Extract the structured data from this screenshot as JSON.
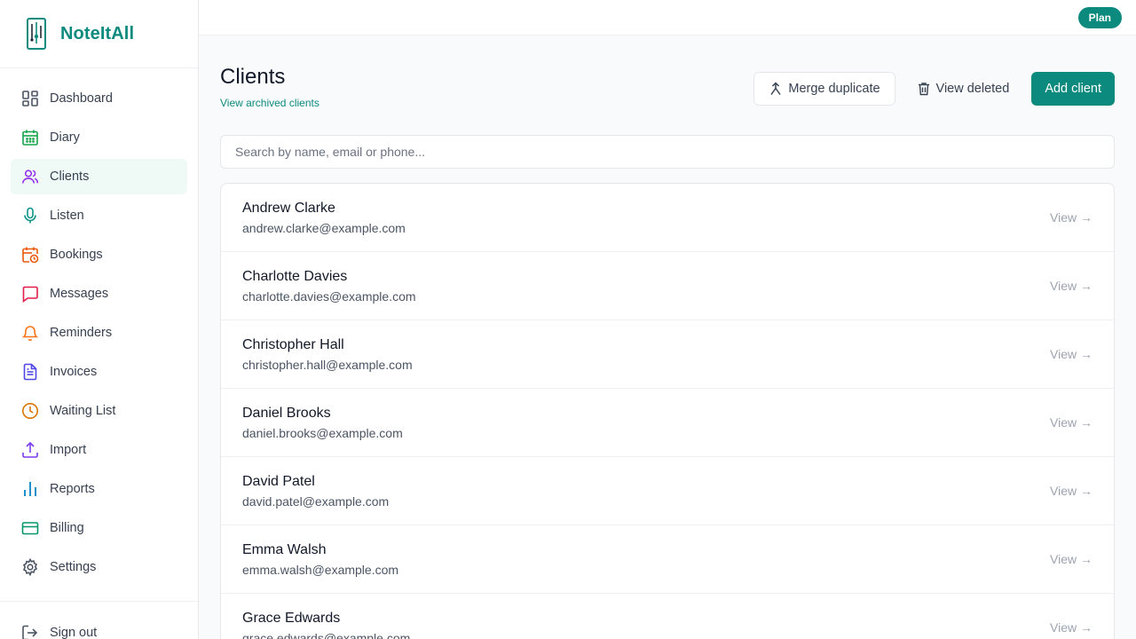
{
  "app": {
    "name": "NoteItAll"
  },
  "topbar": {
    "plan_label": "Plan"
  },
  "sidebar": {
    "items": [
      {
        "label": "Dashboard",
        "icon": "dashboard-icon",
        "color": "#6b7280"
      },
      {
        "label": "Diary",
        "icon": "calendar-icon",
        "color": "#16a34a"
      },
      {
        "label": "Clients",
        "icon": "users-icon",
        "color": "#9333ea",
        "active": true
      },
      {
        "label": "Listen",
        "icon": "microphone-icon",
        "color": "#0d9488"
      },
      {
        "label": "Bookings",
        "icon": "calendar-clock-icon",
        "color": "#ea580c"
      },
      {
        "label": "Messages",
        "icon": "message-icon",
        "color": "#e11d48"
      },
      {
        "label": "Reminders",
        "icon": "bell-icon",
        "color": "#f97316"
      },
      {
        "label": "Invoices",
        "icon": "document-icon",
        "color": "#4f46e5"
      },
      {
        "label": "Waiting List",
        "icon": "clock-icon",
        "color": "#d97706"
      },
      {
        "label": "Import",
        "icon": "upload-icon",
        "color": "#7c3aed"
      },
      {
        "label": "Reports",
        "icon": "bar-chart-icon",
        "color": "#0284c7"
      },
      {
        "label": "Billing",
        "icon": "credit-card-icon",
        "color": "#059669"
      },
      {
        "label": "Settings",
        "icon": "gear-icon",
        "color": "#4b5563"
      }
    ],
    "sign_out": "Sign out"
  },
  "page": {
    "title": "Clients",
    "archived_link": "View archived clients",
    "merge_label": "Merge duplicate",
    "view_deleted_label": "View deleted",
    "add_client_label": "Add client",
    "search_placeholder": "Search by name, email or phone..."
  },
  "clients": [
    {
      "name": "Andrew Clarke",
      "email": "andrew.clarke@example.com",
      "action": "View →"
    },
    {
      "name": "Charlotte Davies",
      "email": "charlotte.davies@example.com",
      "action": "View →"
    },
    {
      "name": "Christopher Hall",
      "email": "christopher.hall@example.com",
      "action": "View →"
    },
    {
      "name": "Daniel Brooks",
      "email": "daniel.brooks@example.com",
      "action": "View →"
    },
    {
      "name": "David Patel",
      "email": "david.patel@example.com",
      "action": "View →"
    },
    {
      "name": "Emma Walsh",
      "email": "emma.walsh@example.com",
      "action": "View →"
    },
    {
      "name": "Grace Edwards",
      "email": "grace.edwards@example.com",
      "action": "View →"
    }
  ],
  "colors": {
    "accent": "#0d8a7e",
    "active_bg": "#effaf6"
  }
}
